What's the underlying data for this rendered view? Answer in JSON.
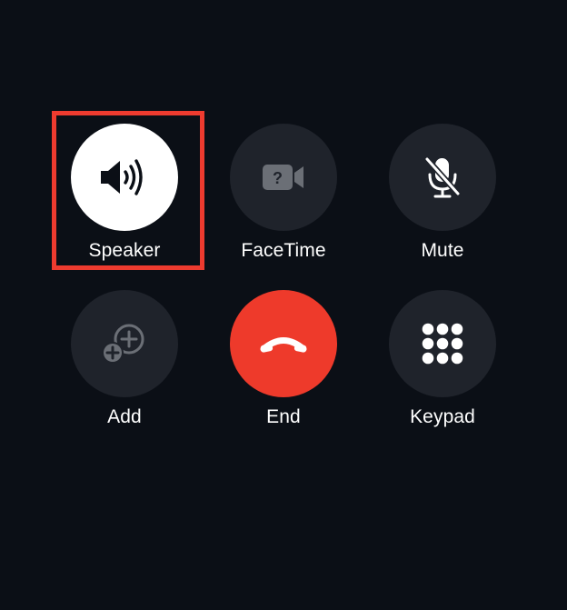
{
  "buttons": [
    {
      "id": "speaker",
      "label": "Speaker",
      "icon": "speaker-icon",
      "state": "active"
    },
    {
      "id": "facetime",
      "label": "FaceTime",
      "icon": "facetime-video-icon",
      "state": "disabled"
    },
    {
      "id": "mute",
      "label": "Mute",
      "icon": "mic-muted-icon",
      "state": "off"
    },
    {
      "id": "add",
      "label": "Add",
      "icon": "add-call-icon",
      "state": "disabled"
    },
    {
      "id": "end",
      "label": "End",
      "icon": "end-call-icon",
      "state": "destructive"
    },
    {
      "id": "keypad",
      "label": "Keypad",
      "icon": "keypad-icon",
      "state": "off"
    }
  ],
  "highlight": {
    "target": "speaker",
    "color": "#ee3b2f"
  },
  "colors": {
    "background": "#0b0f16",
    "button_bg": "#1f232b",
    "active_bg": "#ffffff",
    "end_bg": "#ee3a2b",
    "disabled_icon": "#6b6f76"
  }
}
